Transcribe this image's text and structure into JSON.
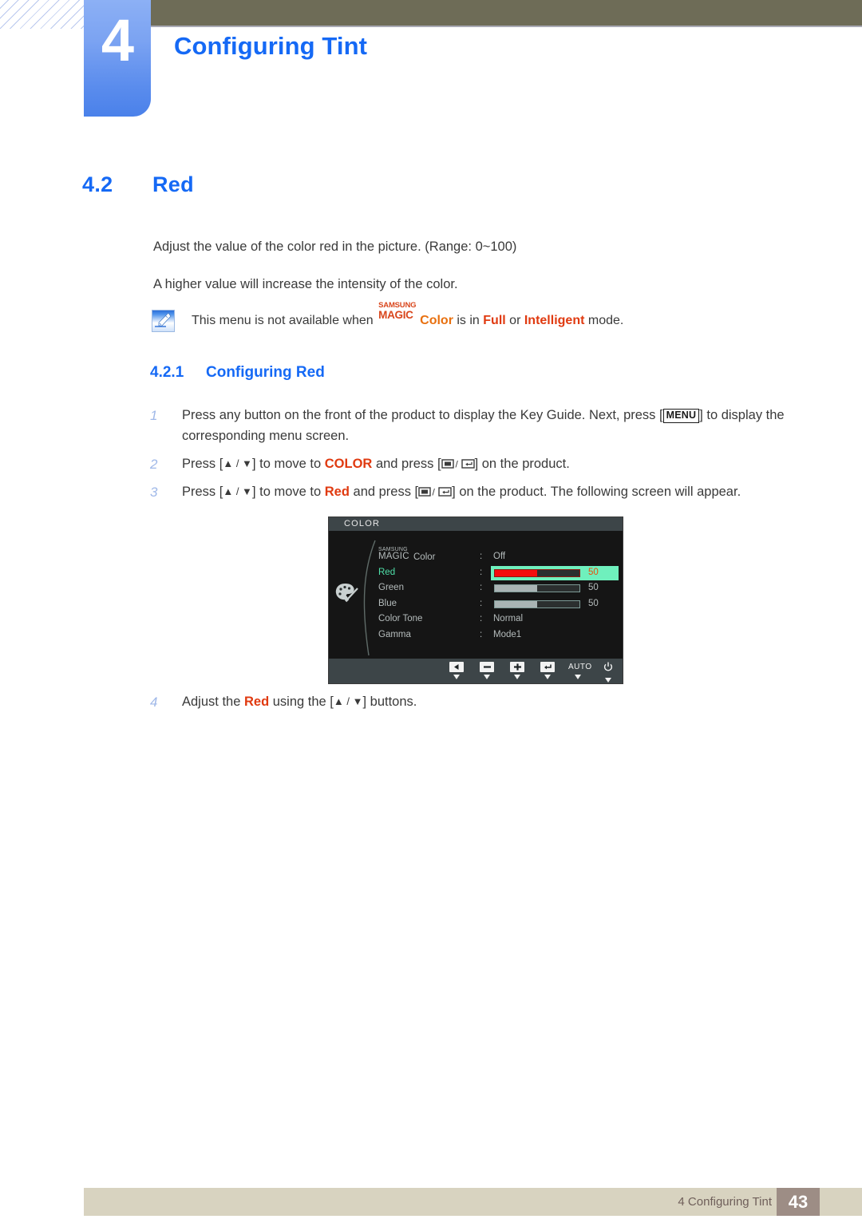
{
  "header": {
    "chapter_number": "4",
    "chapter_title": "Configuring Tint",
    "accent_blue": "#1569f5",
    "olive": "#6e6c57"
  },
  "section": {
    "number": "4.2",
    "title": "Red"
  },
  "paragraphs": {
    "p1": "Adjust the value of the color red in the picture. (Range: 0~100)",
    "p2": "A higher value will increase the intensity of the color."
  },
  "note": {
    "icon": "note-pen-icon",
    "text_before": "This menu is not available when",
    "logo_top": "SAMSUNG",
    "logo_bottom": "MAGIC",
    "logo_suffix": "Color",
    "text_mid": "is in",
    "mode_1": "Full",
    "text_or": "or",
    "mode_2": "Intelligent",
    "text_after": "mode."
  },
  "subsection": {
    "number": "4.2.1",
    "title": "Configuring Red"
  },
  "steps": [
    {
      "number": "1",
      "part_a": "Press any button on the front of the product to display the Key Guide. Next, press [",
      "key": "MENU",
      "part_b": "] to display the corresponding menu screen."
    },
    {
      "number": "2",
      "part_a": "Press [",
      "arrows": "▲ / ▼",
      "part_b": "] to move to",
      "target": "COLOR",
      "part_c": "and press [",
      "part_d": "] on the product."
    },
    {
      "number": "3",
      "part_a": "Press [",
      "arrows": "▲ / ▼",
      "part_b": "] to move to",
      "target": "Red",
      "part_c": "and press [",
      "part_d": "] on the product. The following screen will appear."
    },
    {
      "number": "4",
      "part_a": "Adjust the",
      "target": "Red",
      "part_b": "using the [",
      "arrows": "▲ / ▼",
      "part_c": "] buttons."
    }
  ],
  "osd": {
    "title": "COLOR",
    "icon": "palette-icon",
    "rows": [
      {
        "label_top": "SAMSUNG",
        "label_bottom": "MAGIC",
        "label_suffix": "Color",
        "value": "Off",
        "type": "value",
        "selected": false
      },
      {
        "label": "Red",
        "value": "50",
        "type": "slider",
        "percent": 50,
        "selected": true
      },
      {
        "label": "Green",
        "value": "50",
        "type": "slider",
        "percent": 50,
        "selected": false
      },
      {
        "label": "Blue",
        "value": "50",
        "type": "slider",
        "percent": 50,
        "selected": false
      },
      {
        "label": "Color Tone",
        "value": "Normal",
        "type": "value",
        "selected": false
      },
      {
        "label": "Gamma",
        "value": "Mode1",
        "type": "value",
        "selected": false
      }
    ],
    "colon": ":",
    "buttons": [
      {
        "name": "back-button",
        "glyph": "left-arrow-icon"
      },
      {
        "name": "minus-button",
        "glyph": "minus-icon"
      },
      {
        "name": "plus-button",
        "glyph": "plus-icon"
      },
      {
        "name": "enter-button",
        "glyph": "enter-icon"
      },
      {
        "name": "auto-button",
        "glyph": "text",
        "label": "AUTO"
      },
      {
        "name": "power-button",
        "glyph": "power-icon"
      }
    ],
    "highlight_color": "#6ff0bd",
    "red_fill": "#f50d0d"
  },
  "footer": {
    "text": "4 Configuring Tint",
    "page": "43"
  }
}
